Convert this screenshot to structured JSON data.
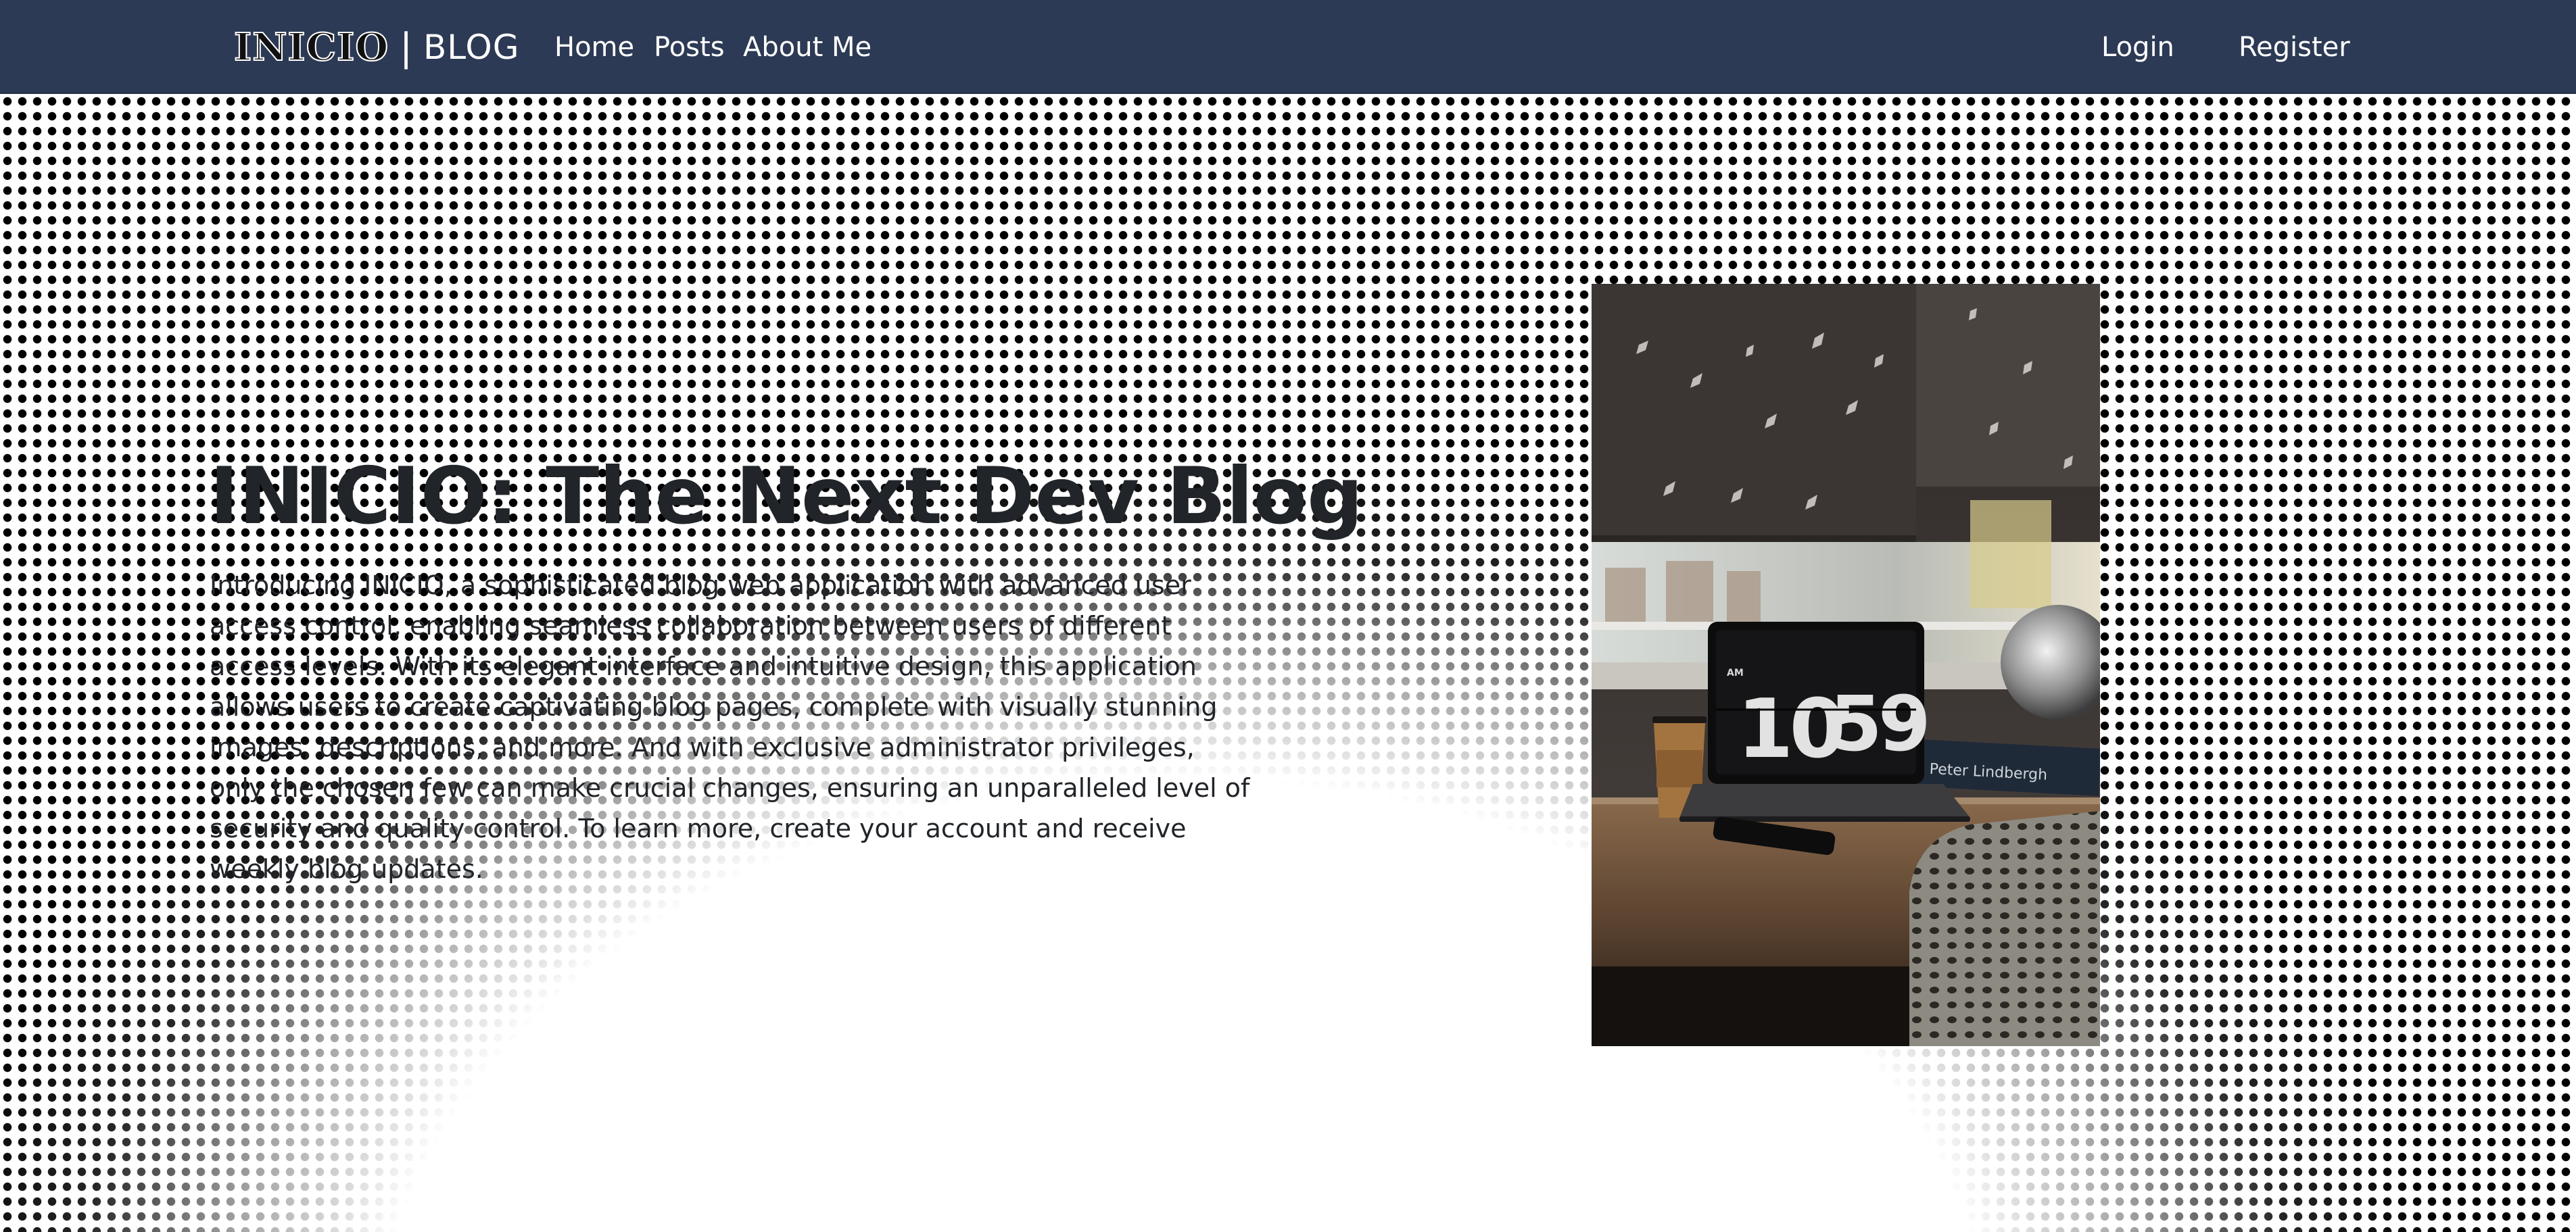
{
  "navbar": {
    "brand_main": "INICIO",
    "brand_separator": "|",
    "brand_sub": "BLOG",
    "links": {
      "home": "Home",
      "posts": "Posts",
      "about": "About Me"
    },
    "login": "Login",
    "register": "Register"
  },
  "hero": {
    "title": "INICIO: The Next Dev Blog",
    "description": "Introducing INICIO, a sophisticated blog web application with advanced user access control, enabling seamless collaboration between users of different access levels. With its elegant interface and intuitive design, this application allows users to create captivating blog pages, complete with visually stunning images, descriptions, and more. And with exclusive administrator privileges, only the chosen few can make crucial changes, ensuring an unparalleled level of security and quality control. To learn more, create your account and receive weekly blog updates."
  },
  "photo": {
    "clock_am": "AM",
    "clock_hour": "10",
    "clock_minute": "59",
    "book_text": "Peter Lindbergh"
  },
  "colors": {
    "navbar_bg": "#2d3a55",
    "text": "#212529",
    "background": "#ffffff"
  }
}
